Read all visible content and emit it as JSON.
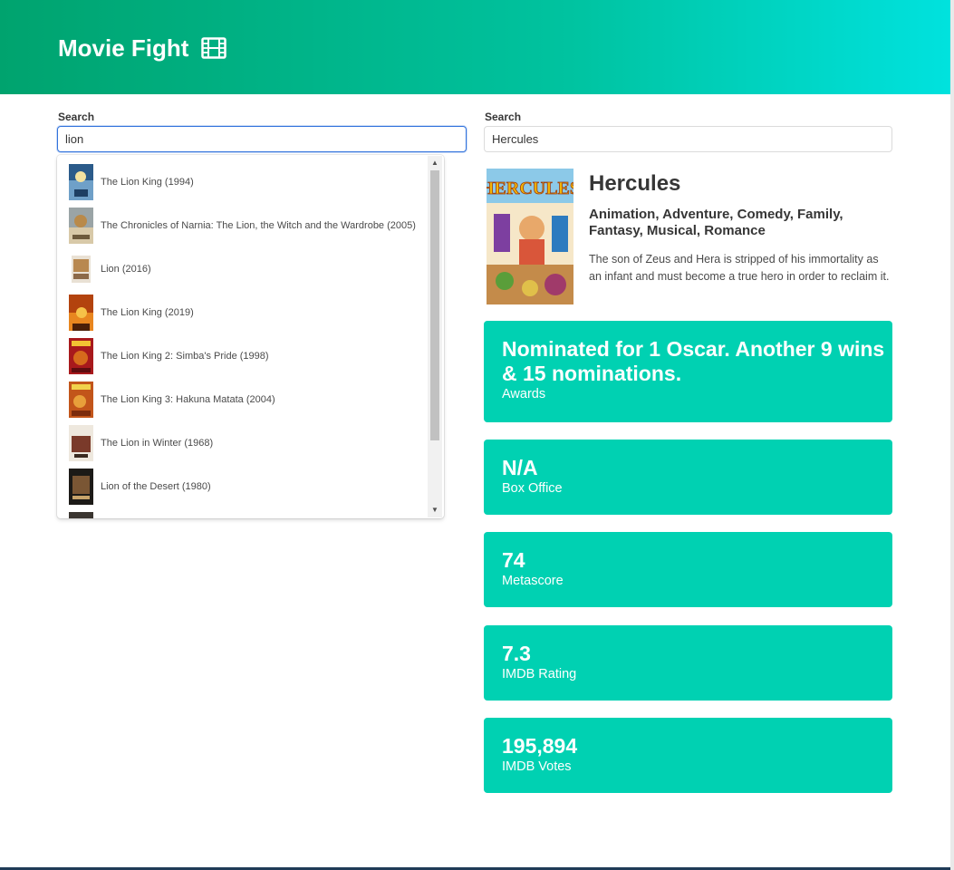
{
  "header": {
    "title": "Movie Fight",
    "icon": "film-icon"
  },
  "left": {
    "search_label": "Search",
    "search_value": "lion",
    "results": [
      {
        "label": "The Lion King (1994)"
      },
      {
        "label": "The Chronicles of Narnia: The Lion, the Witch and the Wardrobe (2005)"
      },
      {
        "label": "Lion (2016)"
      },
      {
        "label": "The Lion King (2019)"
      },
      {
        "label": "The Lion King 2: Simba's Pride (1998)"
      },
      {
        "label": "The Lion King 3: Hakuna Matata (2004)"
      },
      {
        "label": "The Lion in Winter (1968)"
      },
      {
        "label": "Lion of the Desert (1980)"
      }
    ]
  },
  "right": {
    "search_label": "Search",
    "search_value": "Hercules",
    "movie": {
      "title": "Hercules",
      "genre": "Animation, Adventure, Comedy, Family, Fantasy, Musical, Romance",
      "plot": "The son of Zeus and Hera is stripped of his immortality as an infant and must become a true hero in order to reclaim it."
    },
    "stats": [
      {
        "value": "Nominated for 1 Oscar. Another 9 wins & 15 nominations.",
        "label": "Awards"
      },
      {
        "value": "N/A",
        "label": "Box Office"
      },
      {
        "value": "74",
        "label": "Metascore"
      },
      {
        "value": "7.3",
        "label": "IMDB Rating"
      },
      {
        "value": "195,894",
        "label": "IMDB Votes"
      }
    ]
  },
  "colors": {
    "stat_background": "#00d1b2",
    "header_gradient_start": "#00a36e",
    "header_gradient_end": "#00e2de",
    "focus_border": "#3273dc"
  }
}
